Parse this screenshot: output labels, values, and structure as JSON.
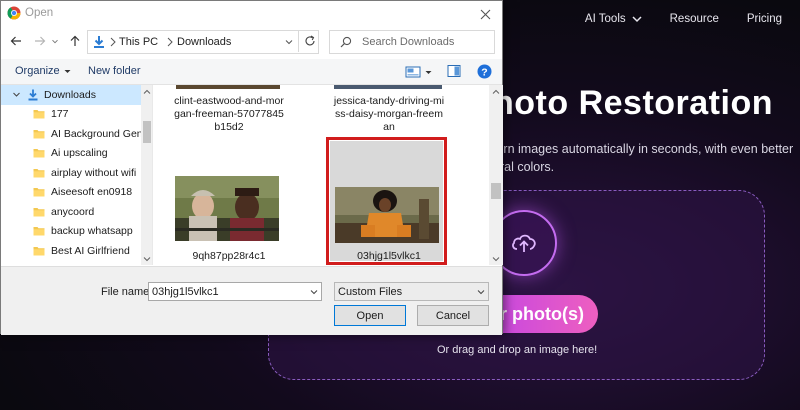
{
  "website": {
    "nav": {
      "ai_tools": "AI Tools",
      "resource": "Resource",
      "pricing": "Pricing"
    },
    "hero_title": "hoto Restoration",
    "hero_subtitle": "torn images automatically in seconds, with even better ural colors.",
    "upload_button": "ur photo(s)",
    "drag_text": "Or drag and drop an image here!",
    "accent_colors": [
      "#b43cf0",
      "#ee5fc0"
    ],
    "icons": [
      "chevron-down-icon",
      "cloud-upload-icon"
    ]
  },
  "dialog": {
    "title": "Open",
    "address": {
      "segments": [
        "This PC",
        "Downloads"
      ]
    },
    "search": {
      "placeholder": "Search Downloads"
    },
    "toolbar": {
      "organize": "Organize",
      "new_folder": "New folder"
    },
    "nav_tree": {
      "selected": "Downloads",
      "items": [
        "Downloads",
        "177",
        "AI Background Generator",
        "Ai upscaling",
        "airplay without wifi",
        "Aiseesoft en0918",
        "anycoord",
        "backup whatsapp",
        "Best AI Girlfriend"
      ]
    },
    "files": [
      {
        "name": "clint-eastwood-and-morgan-freeman-57077845b15d2",
        "lines": [
          "clint-eastwood-and-mor",
          "gan-freeman-57077845",
          "b15d2"
        ]
      },
      {
        "name": "jessica-tandy-driving-miss-daisy-morgan-freeman",
        "lines": [
          "jessica-tandy-driving-mi",
          "ss-daisy-morgan-freem",
          "an"
        ]
      },
      {
        "name": "9qh87pp28r4c1",
        "lines": [
          "9qh87pp28r4c1"
        ]
      },
      {
        "name": "03hjg1l5vlkc1",
        "lines": [
          "03hjg1l5vlkc1"
        ],
        "selected": true
      }
    ],
    "bottom": {
      "file_name_label": "File name:",
      "file_name_value": "03hjg1l5vlkc1",
      "file_type": "Custom Files",
      "open": "Open",
      "cancel": "Cancel"
    },
    "highlight_color": "#d11c1c"
  }
}
